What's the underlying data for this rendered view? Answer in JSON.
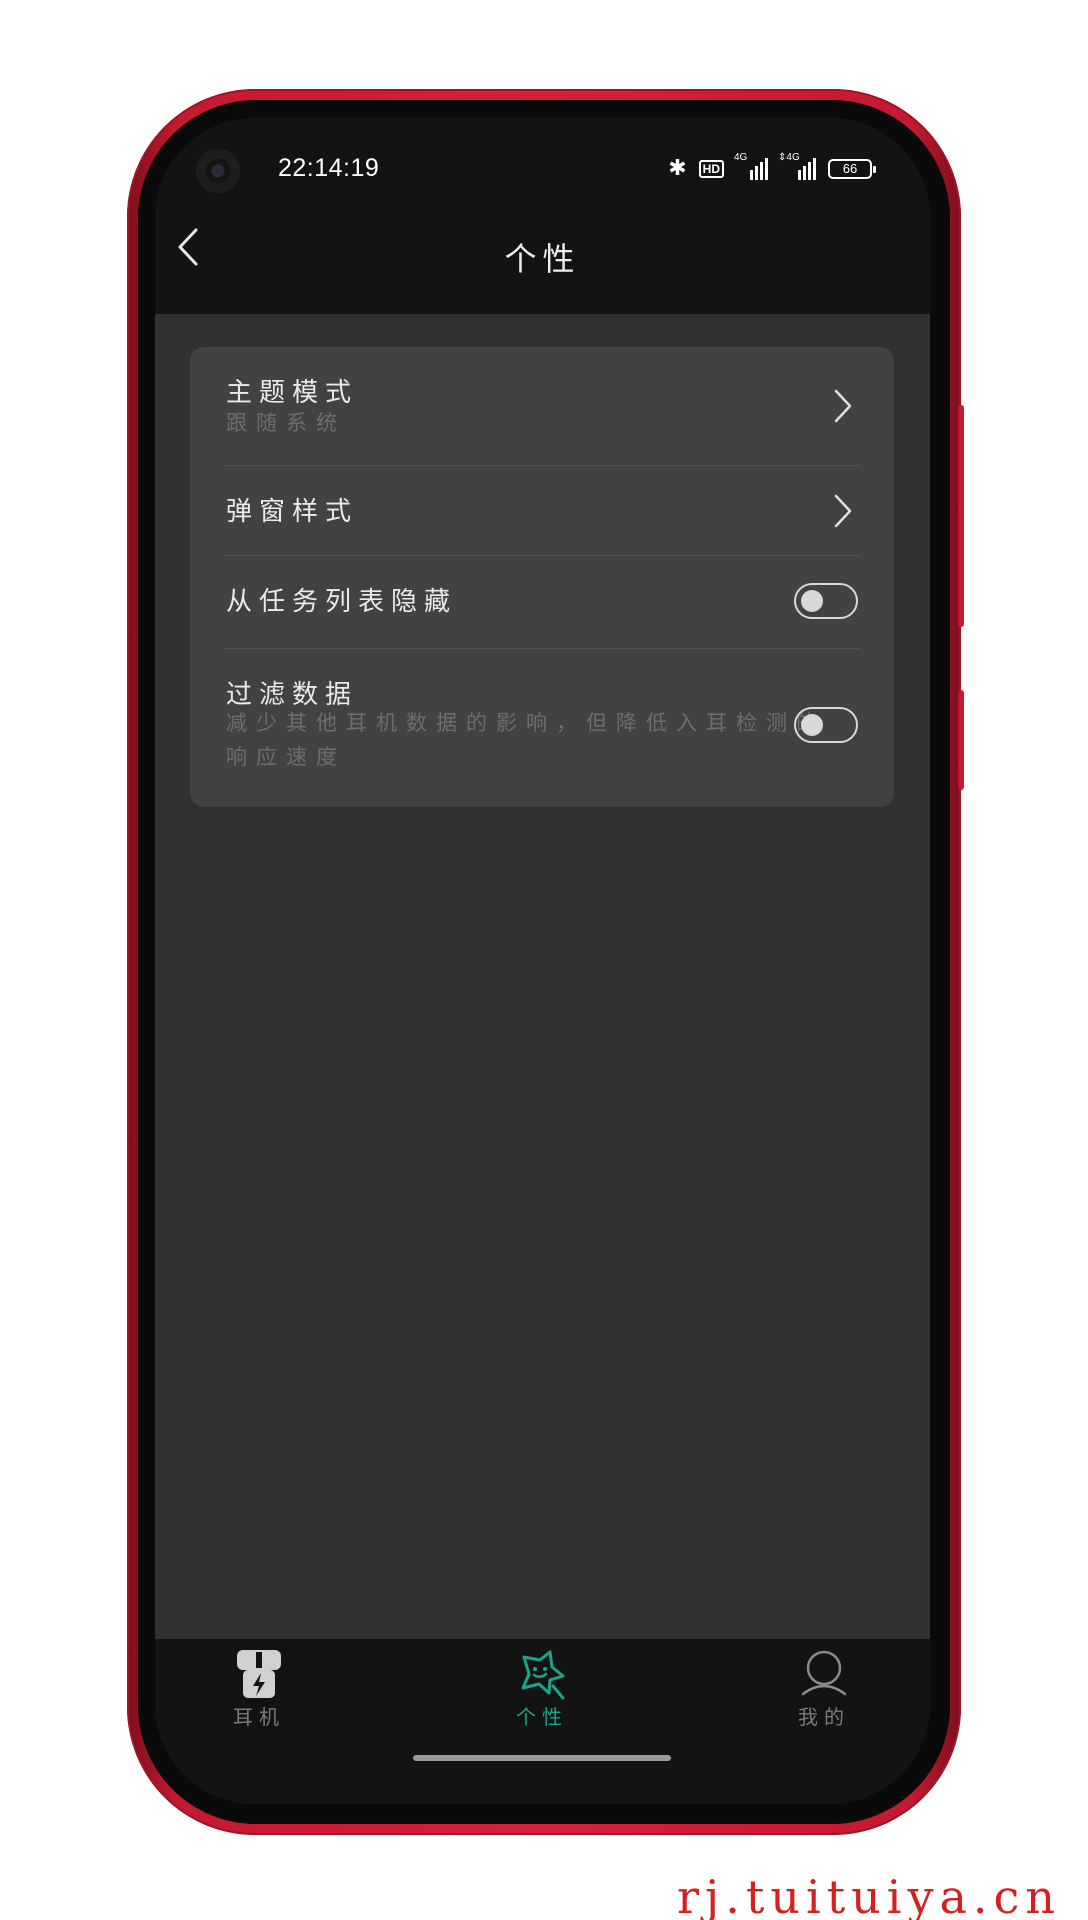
{
  "status_bar": {
    "time": "22:14:19",
    "bluetooth": "✱",
    "hd": "HD",
    "signal1_label": "4G",
    "signal2_label": "⇕4G",
    "battery": "66"
  },
  "header": {
    "title": "个性"
  },
  "settings": {
    "theme_mode": {
      "label": "主题模式",
      "value": "跟随系统"
    },
    "popup_style": {
      "label": "弹窗样式"
    },
    "hide_from_tasks": {
      "label": "从任务列表隐藏",
      "enabled": false
    },
    "filter_data": {
      "label": "过滤数据",
      "description_line1": "减少其他耳机数据的影响，但降低入耳检测的",
      "description_line2": "响应速度",
      "enabled": false
    }
  },
  "bottom_nav": {
    "items": [
      {
        "label": "耳机",
        "icon": "earbuds-icon",
        "active": false
      },
      {
        "label": "个性",
        "icon": "star-face-icon",
        "active": true
      },
      {
        "label": "我的",
        "icon": "person-icon",
        "active": false
      }
    ]
  },
  "colors": {
    "accent": "#1aa58a",
    "inactive": "#7a7a7a",
    "background": "#313131",
    "card": "#424242"
  },
  "watermark": "rj.tuituiya.cn"
}
